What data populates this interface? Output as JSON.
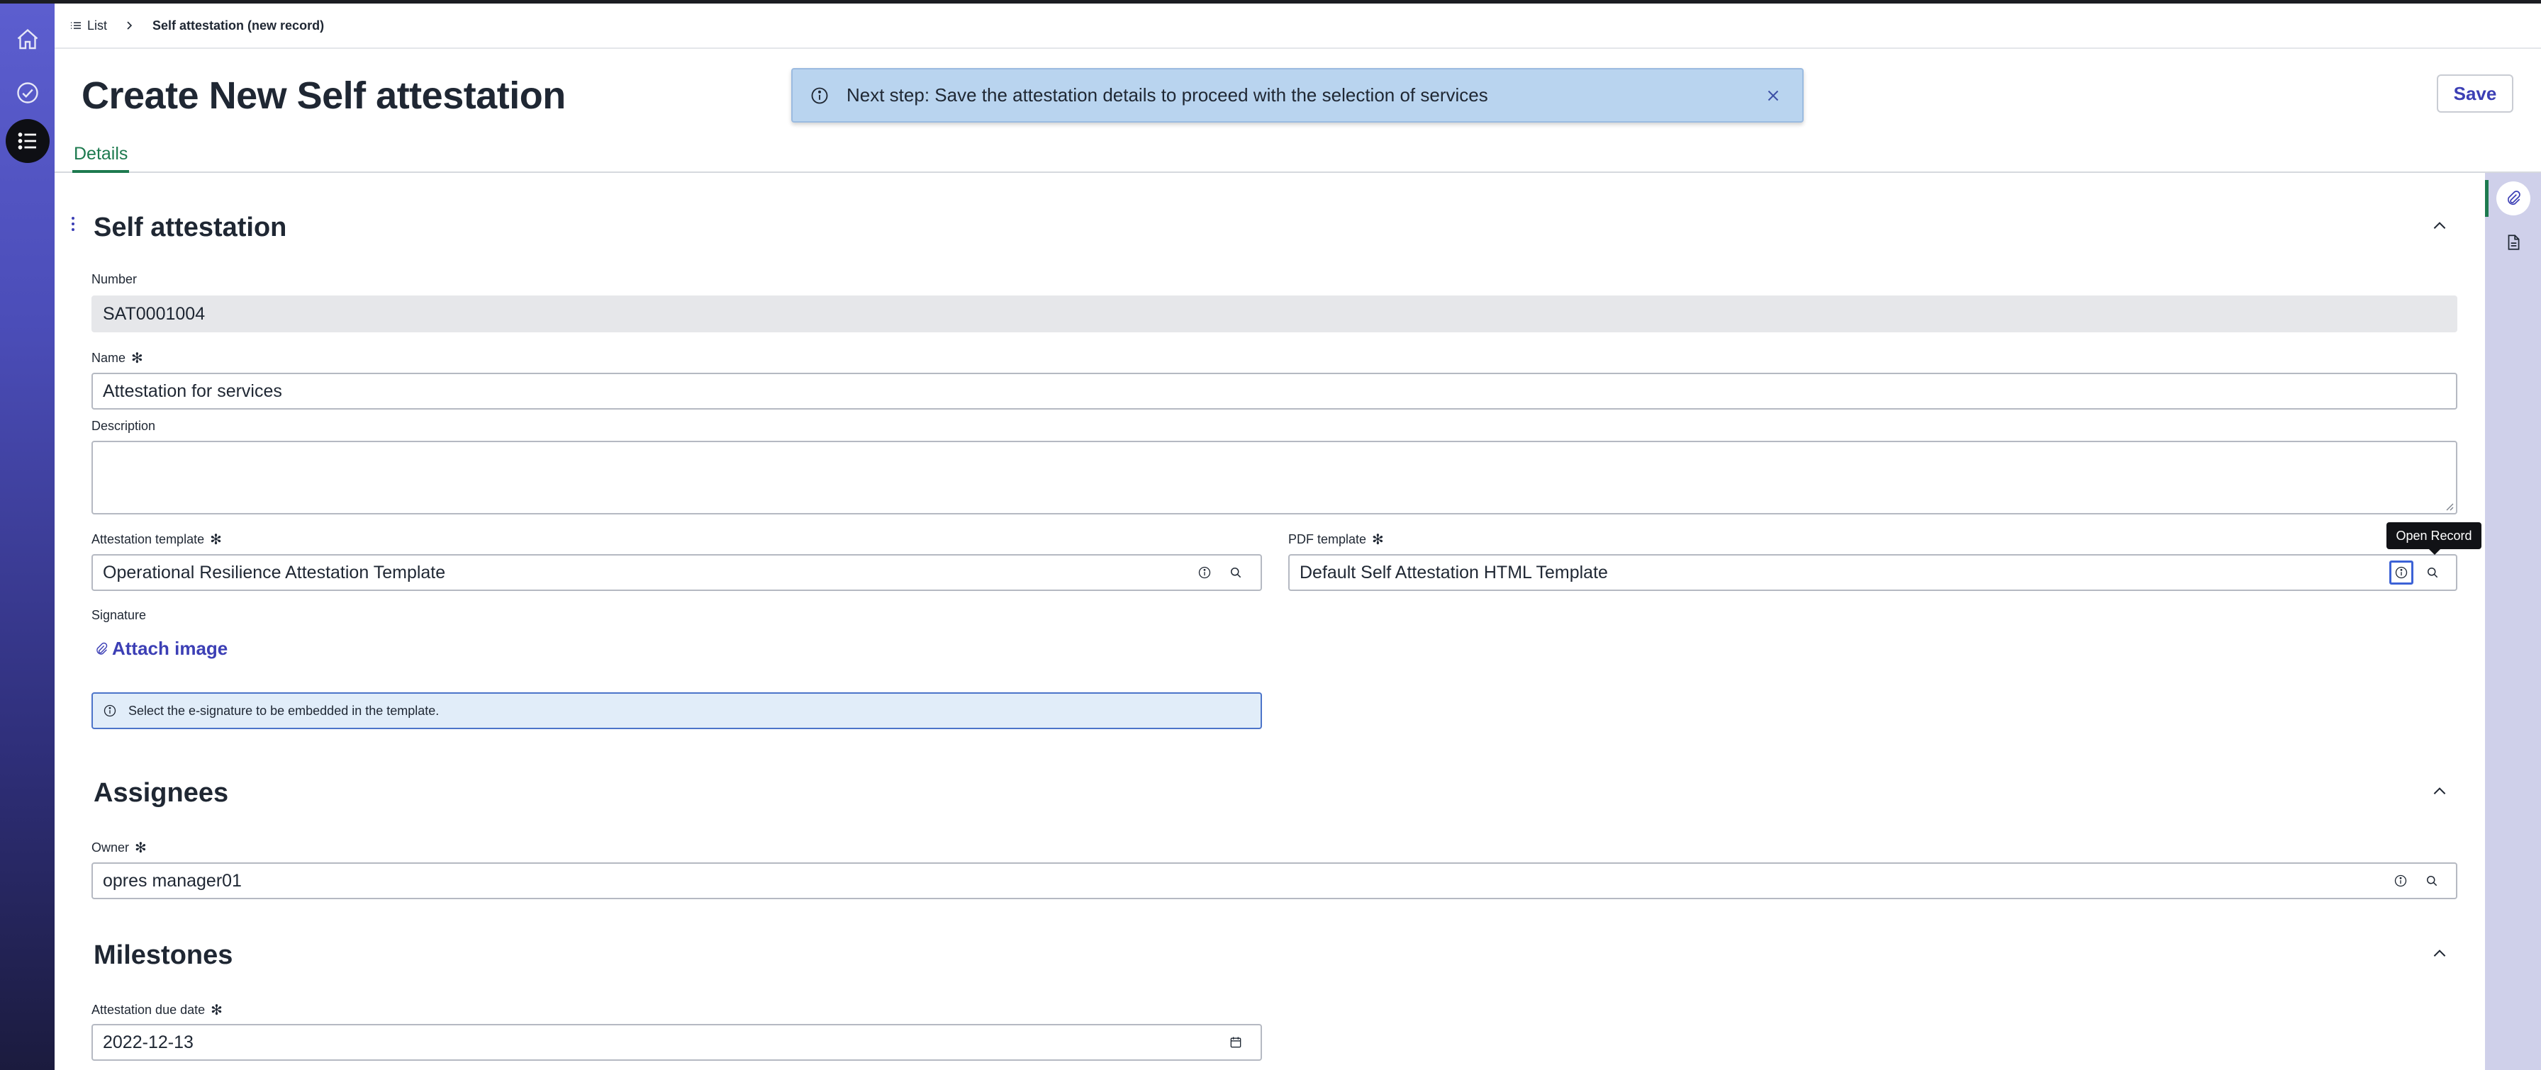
{
  "breadcrumb": {
    "list_label": "List",
    "current": "Self attestation (new record)"
  },
  "header": {
    "title": "Create New Self attestation",
    "save_label": "Save"
  },
  "banner": {
    "message": "Next step: Save the attestation details to proceed with the selection of services"
  },
  "tabs": [
    {
      "label": "Details",
      "active": true
    }
  ],
  "sections": {
    "self_attestation": {
      "title": "Self attestation",
      "number_label": "Number",
      "number_value": "SAT0001004",
      "name_label": "Name",
      "name_value": "Attestation for services",
      "description_label": "Description",
      "description_value": "",
      "template_label": "Attestation template",
      "template_value": "Operational Resilience Attestation Template",
      "pdf_label": "PDF template",
      "pdf_value": "Default Self Attestation HTML Template",
      "signature_label": "Signature",
      "attach_label": "Attach image",
      "info_message": "Select the e-signature to be embedded in the template."
    },
    "assignees": {
      "title": "Assignees",
      "owner_label": "Owner",
      "owner_value": "opres manager01"
    },
    "milestones": {
      "title": "Milestones",
      "due_label": "Attestation due date",
      "due_value": "2022-12-13"
    }
  },
  "tooltip": "Open Record",
  "required_mark": "✻",
  "colors": {
    "accent": "#3c3fb5",
    "tab_active": "#1d7a4f",
    "banner_bg": "#b9d4ef",
    "rail_top": "#5c5ecf"
  },
  "icons": {
    "rail": [
      "home-icon",
      "check-circle-icon",
      "list-icon"
    ],
    "right_rail": [
      "paperclip-icon",
      "document-icon"
    ]
  }
}
